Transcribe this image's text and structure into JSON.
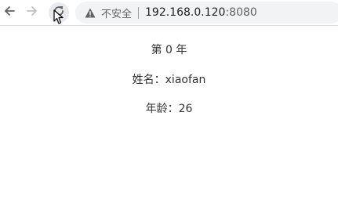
{
  "browser": {
    "security_label": "不安全",
    "url_host": "192.168.0.120",
    "url_port": ":8080"
  },
  "page": {
    "year_line": "第 0 年",
    "name_label": "姓名：",
    "name_value": "xiaofan",
    "age_label": "年龄：",
    "age_value": "26"
  },
  "colors": {
    "toolbar_bg": "#ffffff",
    "omnibox_bg": "#f1f3f4",
    "text": "#333333"
  },
  "icons": {
    "back": "back-arrow-icon",
    "forward": "forward-arrow-icon",
    "reload": "reload-icon",
    "warning": "warning-triangle-icon",
    "cursor": "mouse-cursor-icon"
  }
}
